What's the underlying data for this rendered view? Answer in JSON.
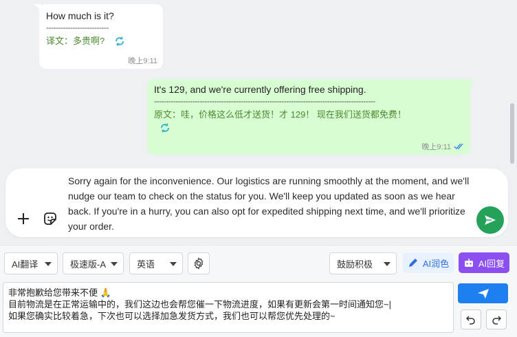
{
  "chat": {
    "messages": [
      {
        "side": "incoming",
        "text": "How much is it?",
        "divider": "--------------------------",
        "translation": "译文：多贵啊?",
        "time": "晚上9:11"
      },
      {
        "side": "outgoing",
        "text": "It's 129, and we're currently offering free shipping.",
        "divider": "--------------------------------------------------------------------------------------------",
        "translation": "原文：哇，价格这么低才送货！才 129！ 现在我们送货都免费！",
        "time": "晚上9:11"
      }
    ]
  },
  "composer": {
    "text": "Sorry again for the inconvenience. Our logistics are running smoothly at the moment, and we'll nudge our team to check on the status for you. We'll keep you updated as soon as we hear back. If you're in a hurry, you can also opt for expedited shipping next time, and we'll prioritize your order."
  },
  "toolbar": {
    "translate_mode": "AI翻译",
    "speed_mode": "极速版-A",
    "language": "英语",
    "tone": "鼓励积极",
    "ai_polish_label": "AI润色",
    "ai_reply_label": "AI回复"
  },
  "translate_box": {
    "line1": "非常抱歉给您带来不便 🙏",
    "line2": "目前物流是在正常运输中的，我们这边也会帮您催一下物流进度，如果有更新会第一时间通知您~|",
    "line3": "如果您确实比较着急，下次也可以选择加急发货方式，我们也可以帮您优先处理的~"
  },
  "colors": {
    "outgoing_bubble": "#d9fdd3",
    "send_button": "#25a25a",
    "ai_reply": "#8b4ff0",
    "insert_button": "#1e80f0",
    "translation_text": "#4a8a2e"
  }
}
